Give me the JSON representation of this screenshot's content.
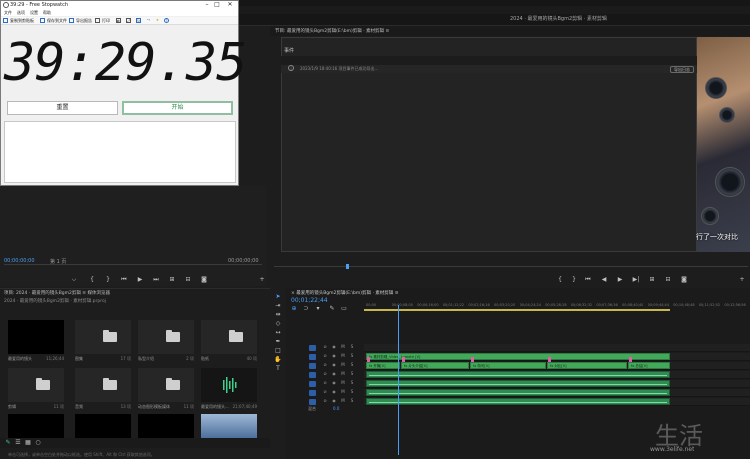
{
  "premiere": {
    "window_title": "2024 · 最爱用的镜头Bgm2剪辑 · 素材剪辑",
    "source_monitor": {
      "timecode": "00;00;00;00",
      "page": "第 1 页",
      "duration": "00;00;00;00"
    },
    "program_monitor": {
      "tab_label": "节目: 最爱用的镜头Bgm2剪辑(E:\\bm)剪辑 · 素材剪辑 ≡",
      "dialog_title": "事件",
      "dialog_message": "2023/1/9 18:40:16  项目事件已成功导出...",
      "dialog_button": "导出日志",
      "subtitle": "行了一次对比"
    },
    "project_panel": {
      "tabs": "项目: 2024 · 最爱用的镜头Bgm2剪辑 ≡   媒体浏览器",
      "file": "2024 · 最爱用的镜头Bgm2剪辑 · 素材剪辑.prproj",
      "items": [
        {
          "name": "最爱用的镜头",
          "duration": "11;26;44",
          "kind": "black"
        },
        {
          "name": "图集",
          "duration": "17 项",
          "kind": "folder"
        },
        {
          "name": "私型介绍",
          "duration": "2 项",
          "kind": "folder"
        },
        {
          "name": "贴纸",
          "duration": "40 项",
          "kind": "folder"
        },
        {
          "name": "剪辑",
          "duration": "11 项",
          "kind": "folder"
        },
        {
          "name": "音频",
          "duration": "13 项",
          "kind": "folder"
        },
        {
          "name": "动态图形模板媒体",
          "duration": "11 项",
          "kind": "folder"
        },
        {
          "name": "最爱用的镜头...",
          "duration": "21;07;40;49",
          "kind": "audio"
        },
        {
          "name": "",
          "duration": "",
          "kind": "black"
        },
        {
          "name": "",
          "duration": "",
          "kind": "black"
        },
        {
          "name": "",
          "duration": "",
          "kind": "black"
        },
        {
          "name": "",
          "duration": "",
          "kind": "image"
        }
      ],
      "status": "单击可选择，或单击空白处并拖动以框选。使用 Shift、Alt 和 Ctrl 获取其他选项。"
    },
    "timeline": {
      "tab_label": "× 最爱用的镜头Bgm2剪辑(E:\\bm)剪辑 · 素材剪辑 ≡",
      "timecode": "00;01;22;44",
      "ruler_ticks": [
        "00;00",
        "00;00;08;00",
        "00;00;16;00",
        "00;01;12;22",
        "00;02;16;16",
        "00;03;20;20",
        "00;04;24;24",
        "00;05;28;28",
        "00;06;32;32",
        "00;07;36;36",
        "00;08;40;40",
        "00;09;44;44",
        "00;10;48;48",
        "00;11;52;52",
        "00;12;56;56"
      ],
      "v_clip_label": "fx 素材剪辑_Video_Lumetri [V]",
      "a_clip_labels": [
        "fx 开篇[V]",
        "fx 片头介绍[V]",
        "fx 特写[V]",
        "fx 对比[V]",
        "fx 总结[V]"
      ],
      "mix_label": "混合",
      "mix_value": "0.0"
    }
  },
  "stopwatch": {
    "title": "39:29 - Free Stopwatch",
    "menu": [
      "文件",
      "选项",
      "设置",
      "帮助"
    ],
    "toolbar": [
      "复制到剪贴板",
      "保存到文件",
      "导出报告",
      "打印"
    ],
    "time": "39:29.35",
    "reset_label": "重置",
    "start_label": "开始"
  },
  "watermark": {
    "text": "www.3elife.net"
  }
}
